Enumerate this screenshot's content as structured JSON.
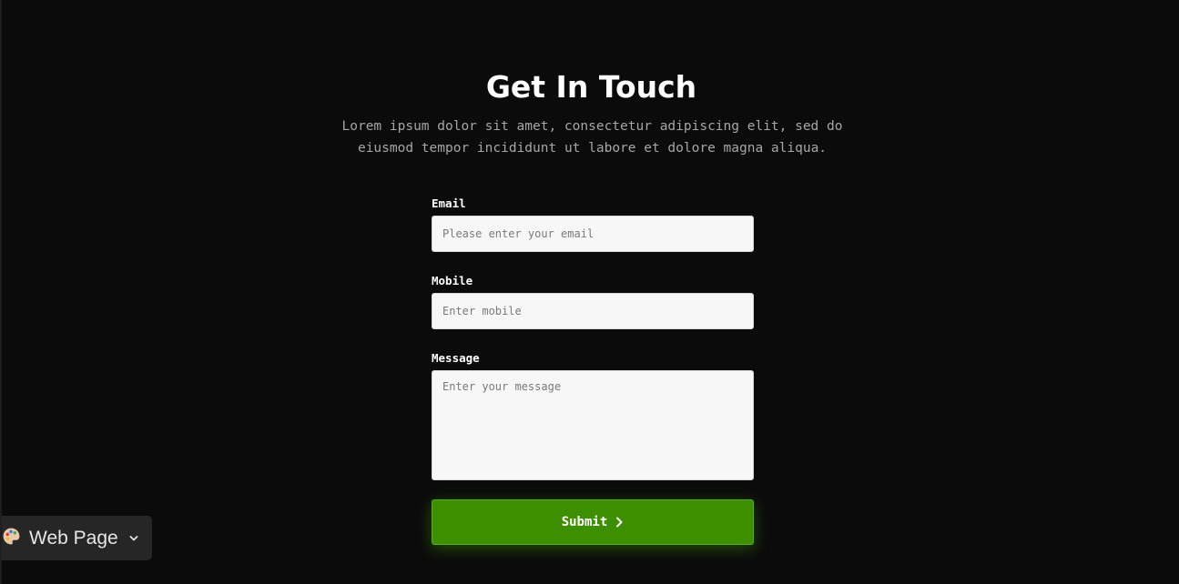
{
  "header": {
    "title": "Get In Touch",
    "subtitle": "Lorem ipsum dolor sit amet, consectetur adipiscing elit, sed do eiusmod tempor incididunt ut labore et dolore magna aliqua."
  },
  "form": {
    "email": {
      "label": "Email",
      "placeholder": "Please enter your email",
      "value": ""
    },
    "mobile": {
      "label": "Mobile",
      "placeholder": "Enter mobile",
      "value": ""
    },
    "message": {
      "label": "Message",
      "placeholder": "Enter your message",
      "value": ""
    },
    "submit_label": "Submit",
    "submit_icon": "chevron-right-icon"
  },
  "badge": {
    "icon": "palette-icon",
    "label": "Web Page",
    "dropdown_icon": "chevron-down-icon"
  },
  "colors": {
    "background": "#0b0b0b",
    "accent": "#3d8f00",
    "field_background": "#f7f7f7",
    "subtitle": "#a6a6a6"
  }
}
